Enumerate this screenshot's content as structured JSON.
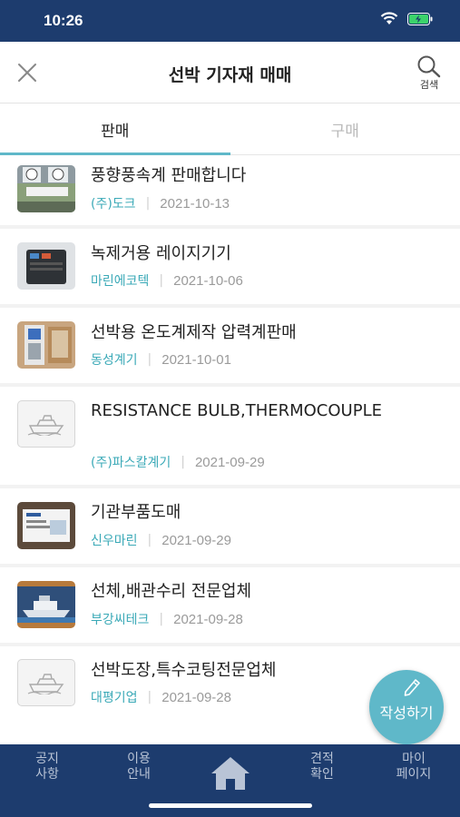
{
  "status_bar": {
    "time": "10:26"
  },
  "header": {
    "title": "선박 기자재 매매",
    "search_label": "검색"
  },
  "tabs": [
    {
      "label": "판매",
      "active": true
    },
    {
      "label": "구매",
      "active": false
    }
  ],
  "listings": [
    {
      "title": "풍향풍속계 판매합니다",
      "company": "(주)도크",
      "date": "2021-10-13",
      "thumbnail": "photo-wind-gauges"
    },
    {
      "title": "녹제거용 레이지기기",
      "company": "마린에코텍",
      "date": "2021-10-06",
      "thumbnail": "photo-laser-device"
    },
    {
      "title": "선박용 온도계제작 압력계판매",
      "company": "동성계기",
      "date": "2021-10-01",
      "thumbnail": "photo-shop-front"
    },
    {
      "title": "RESISTANCE BULB,THERMOCOUPLE",
      "company": "(주)파스칼계기",
      "date": "2021-09-29",
      "thumbnail": "ship-placeholder-icon"
    },
    {
      "title": "기관부품도매",
      "company": "신우마린",
      "date": "2021-09-29",
      "thumbnail": "photo-business-card"
    },
    {
      "title": "선체,배관수리 전문업체",
      "company": "부강씨테크",
      "date": "2021-09-28",
      "thumbnail": "photo-ship-banner"
    },
    {
      "title": "선박도장,특수코팅전문업체",
      "company": "대평기업",
      "date": "2021-09-28",
      "thumbnail": "ship-placeholder-icon"
    }
  ],
  "fab": {
    "label": "작성하기"
  },
  "bottom_nav": [
    {
      "line1": "공지",
      "line2": "사항"
    },
    {
      "line1": "이용",
      "line2": "안내"
    },
    {
      "icon": "home-icon"
    },
    {
      "line1": "견적",
      "line2": "확인"
    },
    {
      "line1": "마이",
      "line2": "페이지"
    }
  ],
  "colors": {
    "navy": "#1d3c6e",
    "accent": "#5fb8c9",
    "company_text": "#3aa9b7"
  }
}
